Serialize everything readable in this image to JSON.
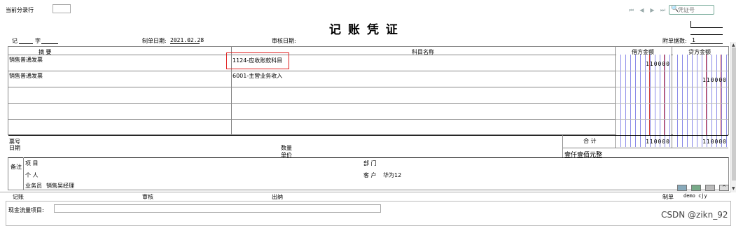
{
  "top": {
    "current_entry_label": "当前分录行",
    "current_entry_value": "",
    "search_placeholder": "凭证号"
  },
  "voucher": {
    "title": "记 账 凭 证",
    "type_label": "记",
    "word_label": "字",
    "make_date_label": "制单日期:",
    "make_date": "2021.02.28",
    "audit_date_label": "审核日期:",
    "attach_label": "附单据数:",
    "attach_count": "1"
  },
  "table": {
    "headers": {
      "summary": "摘 要",
      "account": "科目名称",
      "debit": "借方金额",
      "credit": "贷方金额"
    },
    "rows": [
      {
        "summary": "销售普通发票",
        "account": "1124-应收账款科目",
        "debit": "110000",
        "credit": ""
      },
      {
        "summary": "销售普通发票",
        "account": "6001-主营业务收入",
        "debit": "",
        "credit": "110000"
      },
      {
        "summary": "",
        "account": "",
        "debit": "",
        "credit": ""
      },
      {
        "summary": "",
        "account": "",
        "debit": "",
        "credit": ""
      },
      {
        "summary": "",
        "account": "",
        "debit": "",
        "credit": ""
      }
    ],
    "total": {
      "ticket_label": "票号",
      "date_label": "日期",
      "qty_label": "数量",
      "unit_price_label": "单价",
      "total_label": "合 计",
      "debit": "110000",
      "credit": "110000",
      "amount_words": "壹仟壹佰元整"
    },
    "notes": {
      "notes_label": "备注",
      "project_label": "项 目",
      "department_label": "部 门",
      "person_label": "个 人",
      "customer_label": "客 户",
      "customer_value": "华为12",
      "salesman_label": "业务员",
      "salesman_value": "销售吴经理"
    }
  },
  "footer": {
    "bookkeeper_label": "记账",
    "auditor_label": "审核",
    "cashier_label": "出纳",
    "maker_label": "制单",
    "maker_value": "demo cjy"
  },
  "cashflow": {
    "label": "现金流量项目:",
    "value": ""
  },
  "watermark": "CSDN @zikn_92",
  "colors": {
    "highlight_box": "#e02020",
    "debit_grid": "#7070e0",
    "credit_grid": "#c04040"
  }
}
